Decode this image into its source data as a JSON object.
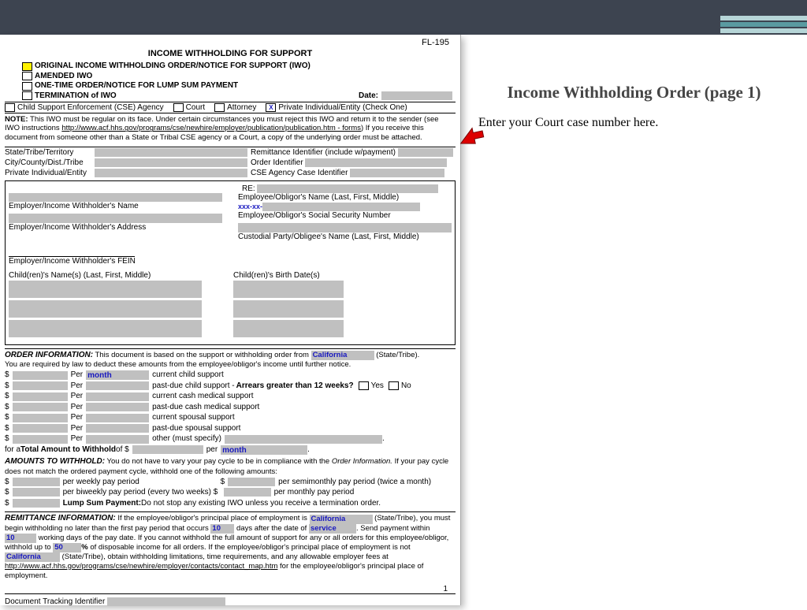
{
  "header": {
    "form_code": "FL-195",
    "title": "INCOME WITHHOLDING FOR SUPPORT"
  },
  "options": {
    "original": "ORIGINAL INCOME WITHHOLDING ORDER/NOTICE FOR SUPPORT (IWO)",
    "amended": "AMENDED IWO",
    "onetime": "ONE-TIME ORDER/NOTICE FOR LUMP SUM PAYMENT",
    "termination": "TERMINATION of IWO",
    "date_label": "Date:"
  },
  "party_bar": {
    "cse": "Child Support Enforcement (CSE) Agency",
    "court": "Court",
    "attorney": "Attorney",
    "private": "Private Individual/Entity  (Check One)"
  },
  "note": {
    "label": "NOTE:",
    "text": " This IWO must be regular on its face. Under certain circumstances you must reject this IWO and return it to the sender (see IWO instructions ",
    "link": "http://www.acf.hhs.gov/programs/cse/newhire/employer/publication/publication.htm - forms",
    "text2": ") If you receive this document from someone other than a State or Tribal CSE agency or a Court, a copy of the underlying order must be attached."
  },
  "rows": {
    "state": "State/Tribe/Territory",
    "remit": "Remittance Identifier (include w/payment)",
    "city": "City/County/Dist./Tribe",
    "order_id": "Order Identifier",
    "priv": "Private Individual/Entity",
    "cse_case": "CSE Agency Case Identifier"
  },
  "section": {
    "re": "RE:",
    "emp_name": "Employer/Income Withholder's Name",
    "obligor_name": "Employee/Obligor's Name (Last, First, Middle)",
    "emp_addr": "Employer/Income Withholder's Address",
    "ssn_masked": "xxx-xx-",
    "ssn_label": "Employee/Obligor's Social Security Number",
    "custodial": "Custodial Party/Obligee's Name (Last, First, Middle)",
    "fein": "Employer/Income Withholder's FEIN",
    "child_names": "Child(ren)'s Name(s) (Last, First, Middle)",
    "child_dob": "Child(ren)'s Birth Date(s)"
  },
  "order_info": {
    "hdr": "ORDER INFORMATION:",
    "intro": " This document is based on the support or withholding order from ",
    "state": "California",
    "state_tribe": "(State/Tribe).",
    "line2": "You are required by law to deduct these amounts from the employee/obligor's income until further notice.",
    "per": "Per",
    "month": "month",
    "desc": [
      "current child support",
      "past-due child support  -   ",
      "current cash medical support",
      "past-due cash medical support",
      "current spousal support",
      "past-due spousal support",
      "other (must specify)"
    ],
    "arrears": "Arrears greater than 12 weeks?",
    "yes": "Yes",
    "no": "No",
    "total": "for a ",
    "total_b": "Total Amount to Withhold",
    "total2": " of $",
    "perw": "per"
  },
  "amounts": {
    "hdr": "AMOUNTS TO WITHHOLD:",
    "txt": " You do not have to vary your pay cycle to be in compliance with the ",
    "oi": "Order Information.",
    "txt2": " If your pay cycle does not match the ordered payment cycle, withhold one of the following amounts:",
    "wk": "per weekly pay period",
    "sm": "per semimonthly pay period (twice a month)",
    "bw": "per biweekly pay period (every two weeks) $",
    "mo": "per monthly pay period",
    "ls": "Lump Sum Payment:",
    "ls2": " Do not stop any existing IWO unless you receive a termination order."
  },
  "remittance": {
    "hdr": "REMITTANCE INFORMATION:",
    "t1": " If the employee/obligor's principal place of employment is ",
    "st": "California",
    "stt": "(State/Tribe),",
    "t2": "you must begin withholding no later than the first pay period that occurs",
    "d10": "10",
    "t3": " days after the date of ",
    "svc": "service",
    "t3b": ". Send",
    "t4": "payment within ",
    "d10b": "10",
    "t5": " working days of the pay date. If you cannot withhold the full amount of support for any or all orders for this employee/obligor, withhold up to ",
    "pct": "50",
    "pct2": "%",
    "t6": " of disposable income for all orders. If the employee/obligor's principal place of employment is not ",
    "st2": "California",
    "t7": " (State/Tribe), obtain withholding limitations, time requirements, and any allowable employer fees at ",
    "link": "http://www.acf.hhs.gov/programs/cse/newhire/employer/contacts/contact_map.htm",
    "t8": " for the employee/obligor's principal place of employment."
  },
  "footer": {
    "page": "1",
    "dti": "Document Tracking Identifier"
  },
  "side": {
    "title": "Income Withholding Order (page 1)",
    "sub": "Enter your Court case number here."
  }
}
